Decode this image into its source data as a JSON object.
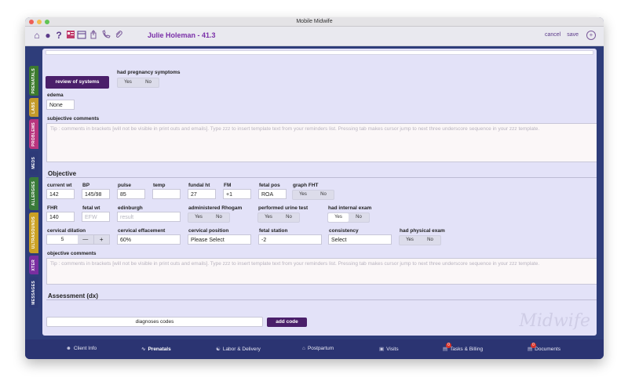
{
  "window": {
    "title": "Mobile Midwife"
  },
  "header": {
    "patient": "Julie Holeman - 41.3",
    "cancel": "cancel",
    "save": "save"
  },
  "sidebar_tabs": [
    {
      "label": "PRENATALS",
      "color": "#3c7a2e"
    },
    {
      "label": "LABS",
      "color": "#c39a2a"
    },
    {
      "label": "PROBLEMS",
      "color": "#b8357e"
    },
    {
      "label": "MEDS",
      "color": "#2d3a78"
    },
    {
      "label": "ALLERGIES",
      "color": "#3a7a3a"
    },
    {
      "label": "ULTRASOUNDS",
      "color": "#c9a024"
    },
    {
      "label": "XTER",
      "color": "#7a2ea0"
    },
    {
      "label": "MESSAGES",
      "color": "#2d3a78"
    }
  ],
  "subjective": {
    "review_button": "review of systems",
    "pregnancy_symptoms_label": "had pregnancy symptoms",
    "yes": "Yes",
    "no": "No",
    "edema_label": "edema",
    "edema_value": "None",
    "comments_label": "subjective comments",
    "comments_placeholder": "Tip : comments in brackets [will not be visible in print outs and emails].  Type zzz to insert template text from your reminders list. Pressing tab makes cursor jump to next three underscore sequence in your zzz template."
  },
  "objective": {
    "section_title": "Objective",
    "current_wt_label": "current wt",
    "current_wt": "142",
    "bp_label": "BP",
    "bp": "145/98",
    "pulse_label": "pulse",
    "pulse": "85",
    "temp_label": "temp",
    "temp": "",
    "fundal_ht_label": "fundal ht",
    "fundal_ht": "27",
    "fm_label": "FM",
    "fm": "+1",
    "fetal_pos_label": "fetal pos",
    "fetal_pos": "ROA",
    "graph_fht_label": "graph FHT",
    "fhr_label": "FHR",
    "fhr": "140",
    "fetal_wt_label": "fetal wt",
    "fetal_wt_placeholder": "EFW",
    "edinburgh_label": "edinburgh",
    "edinburgh_placeholder": "result",
    "rhogam_label": "administered Rhogam",
    "urine_label": "performed urine test",
    "internal_exam_label": "had internal exam",
    "cervical_dilation_label": "cervical dilation",
    "cervical_dilation": "5",
    "stepper_minus": "—",
    "stepper_plus": "+",
    "cervical_effacement_label": "cervical effacement",
    "cervical_effacement": "60%",
    "cervical_position_label": "cervical position",
    "cervical_position": "Please Select",
    "fetal_station_label": "fetal station",
    "fetal_station": "-2",
    "consistency_label": "consistency",
    "consistency": "Select",
    "physical_exam_label": "had physical exam",
    "comments_label": "objective comments",
    "comments_placeholder": "Tip : comments in brackets [will not be visible in print outs and emails].  Type zzz to insert template text from your reminders list. Pressing tab makes cursor jump to next three underscore sequence in your zzz template."
  },
  "assessment": {
    "section_title": "Assessment (dx)",
    "diagnoses_label": "diagnoses codes",
    "add_code": "add code"
  },
  "watermark": "Midwife",
  "bottom_nav": [
    {
      "label": "Client Info",
      "icon": "person-icon"
    },
    {
      "label": "Prenatals",
      "icon": "heartbeat-icon"
    },
    {
      "label": "Labor & Delivery",
      "icon": "baby-icon"
    },
    {
      "label": "Postpartum",
      "icon": "home-icon"
    },
    {
      "label": "Visits",
      "icon": "car-icon"
    },
    {
      "label": "Tasks & Billing",
      "icon": "tasks-icon",
      "badge": "0"
    },
    {
      "label": "Documents",
      "icon": "documents-icon",
      "badge": "0"
    }
  ]
}
